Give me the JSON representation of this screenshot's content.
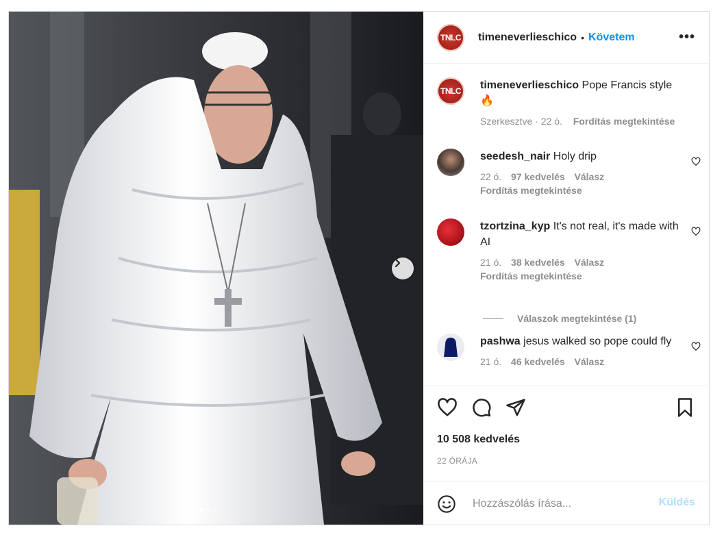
{
  "post": {
    "username": "timeneverlieschico",
    "avatar_text": "TNLC",
    "follow_label": "Követem",
    "separator": "•",
    "more_label": "•••",
    "caption_text": "Pope Francis style",
    "caption_emoji": "🔥",
    "caption_meta": "Szerkesztve · 22 ó.",
    "caption_translate": "Fordítás megtekintése"
  },
  "media": {
    "carousel_count": 3,
    "carousel_active": 1,
    "next_icon": "chevron-right-icon"
  },
  "comments": [
    {
      "user": "seedesh_nair",
      "text": "Holy drip",
      "time": "22 ó.",
      "likes": "97 kedvelés",
      "reply": "Válasz",
      "translate": "Fordítás megtekintése"
    },
    {
      "user": "tzortzina_kyp",
      "text": "It's not real, it's made with AI",
      "time": "21 ó.",
      "likes": "38 kedvelés",
      "reply": "Válasz",
      "translate": "Fordítás megtekintése"
    },
    {
      "user": "pashwa",
      "text": "jesus walked so pope could fly",
      "time": "21 ó.",
      "likes": "46 kedvelés",
      "reply": "Válasz"
    }
  ],
  "view_replies": "Válaszok megtekintése (1)",
  "actions": {
    "like_icon": "heart-icon",
    "comment_icon": "comment-icon",
    "share_icon": "send-icon",
    "save_icon": "bookmark-icon"
  },
  "likes": "10 508 kedvelés",
  "time": "22 ÓRÁJA",
  "add_comment": {
    "placeholder": "Hozzászólás írása...",
    "send_label": "Küldés",
    "emoji_icon": "smiley-icon"
  },
  "colors": {
    "accent": "#0095f6",
    "send_disabled": "#b2dffc",
    "muted": "#8e8e8e"
  }
}
